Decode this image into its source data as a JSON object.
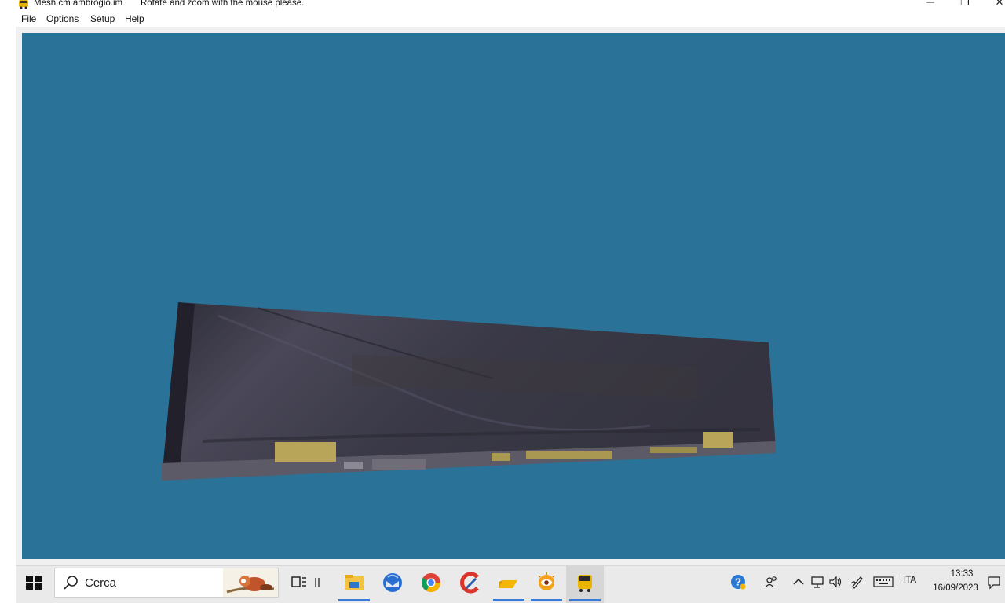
{
  "window": {
    "title": "Mesh cm ambrogio.im",
    "hint": "Rotate and zoom with the mouse please.",
    "minimize_glyph": "─",
    "maximize_glyph": "❐",
    "close_glyph": "✕"
  },
  "menu": {
    "file": "File",
    "options": "Options",
    "setup": "Setup",
    "help": "Help"
  },
  "viewport": {
    "background_color": "#2b7298",
    "mesh_color": "#3b3a4a"
  },
  "taskbar": {
    "search_placeholder": "Cerca",
    "language": "ITA",
    "time": "13:33",
    "date": "16/09/2023",
    "apps": [
      "task-view-icon",
      "file-explorer-icon",
      "thunderbird-icon",
      "chrome-icon",
      "ccleaner-icon",
      "folder-app-icon",
      "xnview-icon",
      "bus-app-icon"
    ],
    "tray_icons": [
      "help-icon",
      "people-icon",
      "chevron-up-icon",
      "network-icon",
      "volume-icon",
      "pen-icon",
      "keyboard-icon",
      "notification-icon"
    ]
  }
}
